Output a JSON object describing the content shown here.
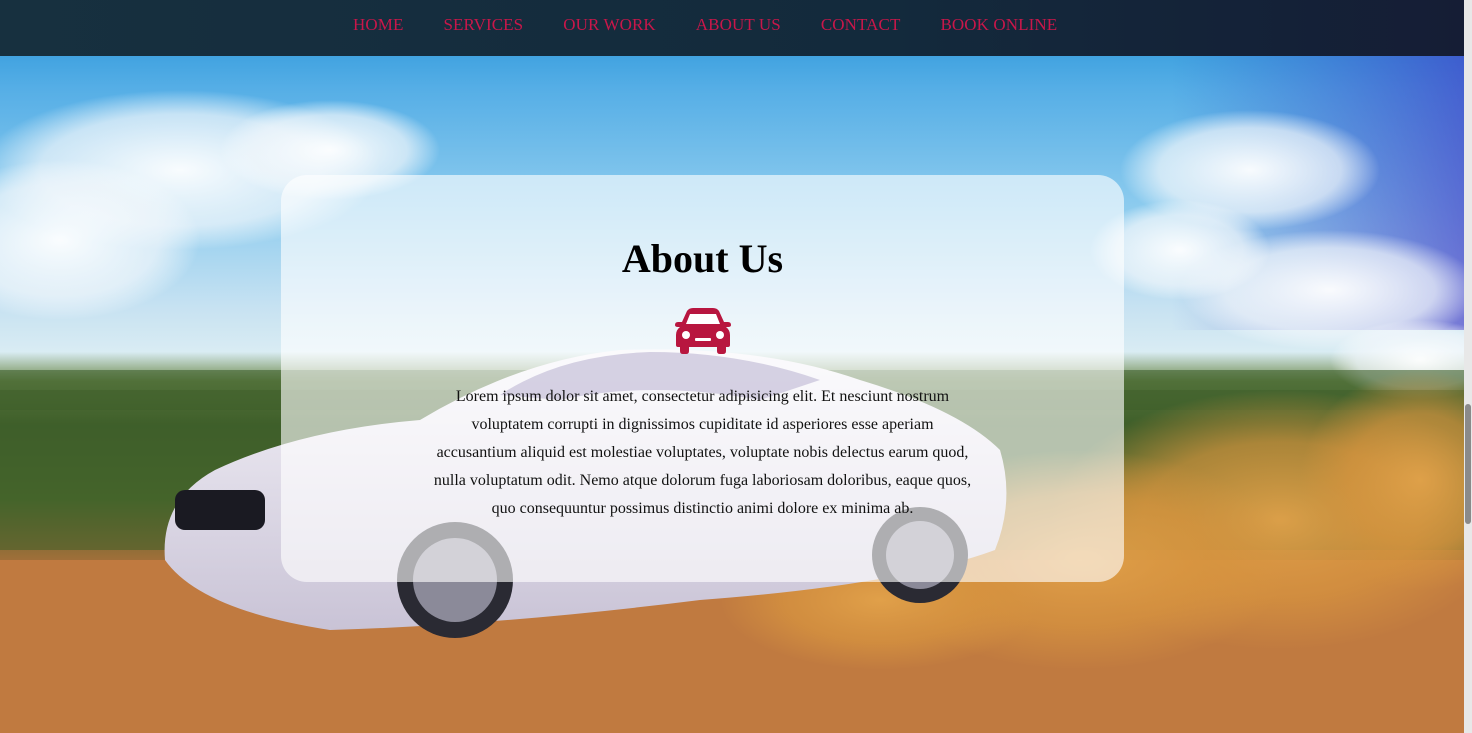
{
  "nav": {
    "items": [
      {
        "label": "HOME"
      },
      {
        "label": "SERVICES"
      },
      {
        "label": "OUR WORK"
      },
      {
        "label": "ABOUT US"
      },
      {
        "label": "CONTACT"
      },
      {
        "label": "BOOK ONLINE"
      }
    ],
    "link_color": "#c8174a"
  },
  "about": {
    "title": "About Us",
    "icon": "car-icon",
    "icon_color": "#b8163f",
    "body": "Lorem ipsum dolor sit amet, consectetur adipisicing elit. Et nesciunt nostrum voluptatem corrupti in dignissimos cupiditate id asperiores esse aperiam accusantium aliquid est molestiae voluptates, voluptate nobis delectus earum quod, nulla voluptatum odit. Nemo atque dolorum fuga laboriosam doloribus, eaque quos, quo consequuntur possimus distinctio animi dolore ex minima ab."
  },
  "background": {
    "image": "car-drift-hero-image"
  }
}
